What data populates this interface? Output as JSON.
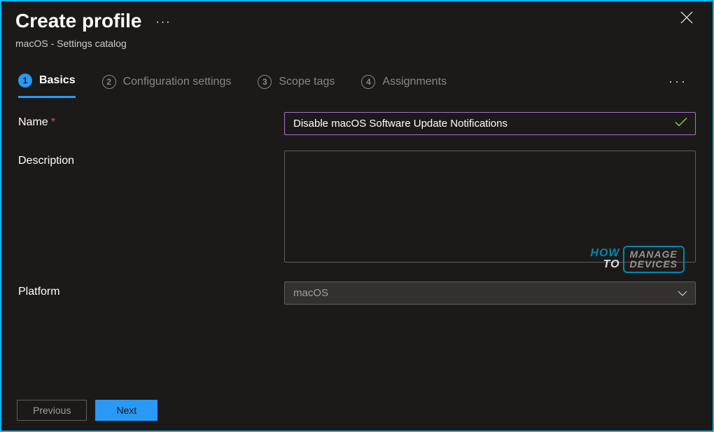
{
  "header": {
    "title": "Create profile",
    "subtitle": "macOS - Settings catalog"
  },
  "tabs": [
    {
      "num": "1",
      "label": "Basics",
      "active": true
    },
    {
      "num": "2",
      "label": "Configuration settings",
      "active": false
    },
    {
      "num": "3",
      "label": "Scope tags",
      "active": false
    },
    {
      "num": "4",
      "label": "Assignments",
      "active": false
    }
  ],
  "form": {
    "name_label": "Name",
    "name_value": "Disable macOS Software Update Notifications",
    "description_label": "Description",
    "description_value": "",
    "platform_label": "Platform",
    "platform_value": "macOS"
  },
  "footer": {
    "previous": "Previous",
    "next": "Next"
  },
  "watermark": {
    "how": "HOW",
    "to": "TO",
    "manage": "MANAGE",
    "devices": "DEVICES"
  }
}
